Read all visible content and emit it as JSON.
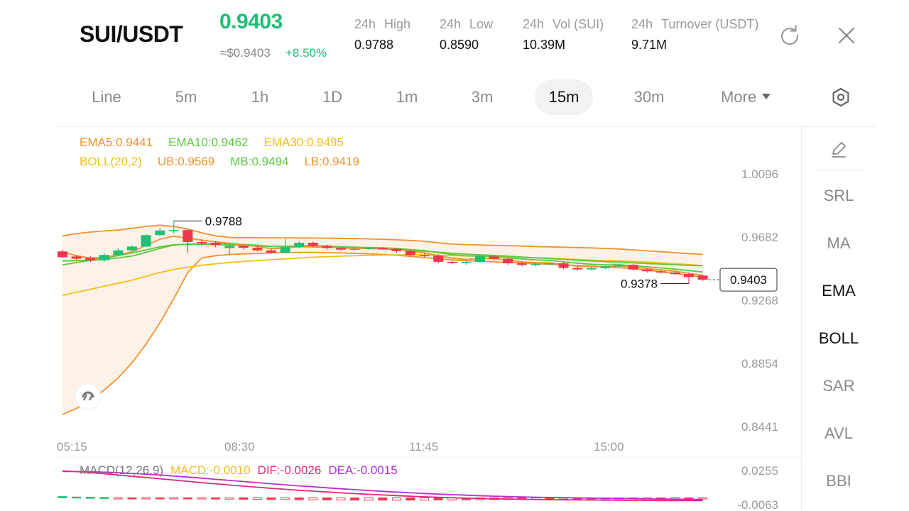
{
  "header": {
    "pair": "SUI/USDT",
    "last_price": "0.9403",
    "usd_price": "≈$0.9403",
    "change": "+8.50%",
    "stats": [
      {
        "k1": "24h",
        "k2": "High",
        "value": "0.9788"
      },
      {
        "k1": "24h",
        "k2": "Low",
        "value": "0.8590"
      },
      {
        "k1": "24h",
        "k2": "Vol (SUI)",
        "value": "10.39M"
      },
      {
        "k1": "24h",
        "k2": "Turnover (USDT)",
        "value": "9.71M"
      }
    ],
    "icons": {
      "refresh": "refresh-icon",
      "close": "close-icon"
    }
  },
  "timeframes": {
    "items": [
      "Line",
      "5m",
      "1h",
      "1D",
      "1m",
      "3m",
      "15m",
      "30m"
    ],
    "active": "15m",
    "more_label": "More",
    "settings_icon": "hexagon-settings-icon"
  },
  "indicators": {
    "ema5": "EMA5:0.9441",
    "ema10": "EMA10:0.9462",
    "ema30": "EMA30:0.9495",
    "boll": "BOLL(20,2)",
    "ub": "UB:0.9569",
    "mb": "MB:0.9494",
    "lb": "LB:0.9419",
    "macd_title": "MACD(12,26,9)",
    "macd": "MACD:-0.0010",
    "dif": "DIF:-0.0026",
    "dea": "DEA:-0.0015"
  },
  "sidebar": {
    "draw_icon": "pencil-icon",
    "items": [
      "SRL",
      "MA",
      "EMA",
      "BOLL",
      "SAR",
      "AVL",
      "BBI"
    ],
    "active": [
      "EMA",
      "BOLL"
    ]
  },
  "colors": {
    "up": "#1fbf75",
    "down": "#f0364f",
    "ema5": "#f0922e",
    "ema10": "#5ac93f",
    "ema30": "#f2be1a",
    "boll_band": "#f0922e",
    "boll_fill": "#fdeee0",
    "dif": "#e0297c",
    "dea": "#b32fd3"
  },
  "chart_data": {
    "type": "candlestick",
    "y_ticks": [
      "1.0096",
      "0.9682",
      "0.9268",
      "0.8854",
      "0.8441"
    ],
    "ylim": [
      0.8441,
      1.0096
    ],
    "x_ticks": [
      "05:15",
      "08:30",
      "11:45",
      "15:00"
    ],
    "high_marker": "0.9788",
    "low_marker": "0.9378",
    "current_price_tag": "0.9403",
    "candles": [
      {
        "o": 0.9588,
        "c": 0.955,
        "h": 0.96,
        "l": 0.9545
      },
      {
        "o": 0.9555,
        "c": 0.954,
        "h": 0.9565,
        "l": 0.953
      },
      {
        "o": 0.9545,
        "c": 0.953,
        "h": 0.9558,
        "l": 0.9518
      },
      {
        "o": 0.953,
        "c": 0.9565,
        "h": 0.9575,
        "l": 0.952
      },
      {
        "o": 0.9565,
        "c": 0.9595,
        "h": 0.9608,
        "l": 0.956
      },
      {
        "o": 0.9595,
        "c": 0.962,
        "h": 0.9628,
        "l": 0.9585
      },
      {
        "o": 0.962,
        "c": 0.9695,
        "h": 0.97,
        "l": 0.9615
      },
      {
        "o": 0.9695,
        "c": 0.9725,
        "h": 0.974,
        "l": 0.969
      },
      {
        "o": 0.9725,
        "c": 0.9728,
        "h": 0.9788,
        "l": 0.9705
      },
      {
        "o": 0.9728,
        "c": 0.965,
        "h": 0.9735,
        "l": 0.958
      },
      {
        "o": 0.965,
        "c": 0.9645,
        "h": 0.9668,
        "l": 0.9628
      },
      {
        "o": 0.9645,
        "c": 0.963,
        "h": 0.9655,
        "l": 0.9615
      },
      {
        "o": 0.961,
        "c": 0.9625,
        "h": 0.9632,
        "l": 0.9565
      },
      {
        "o": 0.9625,
        "c": 0.9612,
        "h": 0.9632,
        "l": 0.96
      },
      {
        "o": 0.9612,
        "c": 0.9595,
        "h": 0.9622,
        "l": 0.9588
      },
      {
        "o": 0.9595,
        "c": 0.958,
        "h": 0.9605,
        "l": 0.9572
      },
      {
        "o": 0.958,
        "c": 0.9615,
        "h": 0.9668,
        "l": 0.9575
      },
      {
        "o": 0.9615,
        "c": 0.9645,
        "h": 0.9655,
        "l": 0.9608
      },
      {
        "o": 0.9645,
        "c": 0.9625,
        "h": 0.9652,
        "l": 0.9615
      },
      {
        "o": 0.9625,
        "c": 0.961,
        "h": 0.9632,
        "l": 0.96
      },
      {
        "o": 0.961,
        "c": 0.96,
        "h": 0.9618,
        "l": 0.959
      },
      {
        "o": 0.96,
        "c": 0.9605,
        "h": 0.9612,
        "l": 0.9592
      },
      {
        "o": 0.9605,
        "c": 0.961,
        "h": 0.9615,
        "l": 0.9598
      },
      {
        "o": 0.961,
        "c": 0.9605,
        "h": 0.9618,
        "l": 0.96
      },
      {
        "o": 0.9605,
        "c": 0.959,
        "h": 0.9612,
        "l": 0.958
      },
      {
        "o": 0.959,
        "c": 0.9565,
        "h": 0.96,
        "l": 0.955
      },
      {
        "o": 0.9565,
        "c": 0.956,
        "h": 0.9575,
        "l": 0.955
      },
      {
        "o": 0.956,
        "c": 0.952,
        "h": 0.9568,
        "l": 0.951
      },
      {
        "o": 0.952,
        "c": 0.9512,
        "h": 0.953,
        "l": 0.9505
      },
      {
        "o": 0.9512,
        "c": 0.952,
        "h": 0.9528,
        "l": 0.95
      },
      {
        "o": 0.952,
        "c": 0.9555,
        "h": 0.9562,
        "l": 0.9515
      },
      {
        "o": 0.9555,
        "c": 0.954,
        "h": 0.9562,
        "l": 0.953
      },
      {
        "o": 0.954,
        "c": 0.951,
        "h": 0.9548,
        "l": 0.95
      },
      {
        "o": 0.951,
        "c": 0.95,
        "h": 0.952,
        "l": 0.949
      },
      {
        "o": 0.95,
        "c": 0.9505,
        "h": 0.9512,
        "l": 0.9492
      },
      {
        "o": 0.9505,
        "c": 0.951,
        "h": 0.9516,
        "l": 0.9498
      },
      {
        "o": 0.951,
        "c": 0.948,
        "h": 0.9518,
        "l": 0.947
      },
      {
        "o": 0.948,
        "c": 0.947,
        "h": 0.949,
        "l": 0.9462
      },
      {
        "o": 0.947,
        "c": 0.9478,
        "h": 0.9485,
        "l": 0.9465
      },
      {
        "o": 0.9478,
        "c": 0.949,
        "h": 0.9496,
        "l": 0.9472
      },
      {
        "o": 0.949,
        "c": 0.9502,
        "h": 0.9508,
        "l": 0.9484
      },
      {
        "o": 0.95,
        "c": 0.947,
        "h": 0.9506,
        "l": 0.9462
      },
      {
        "o": 0.947,
        "c": 0.9458,
        "h": 0.9478,
        "l": 0.945
      },
      {
        "o": 0.9458,
        "c": 0.945,
        "h": 0.9466,
        "l": 0.9444
      },
      {
        "o": 0.945,
        "c": 0.944,
        "h": 0.9458,
        "l": 0.9432
      },
      {
        "o": 0.944,
        "c": 0.942,
        "h": 0.9448,
        "l": 0.9378
      },
      {
        "o": 0.943,
        "c": 0.9403,
        "h": 0.9436,
        "l": 0.9395
      }
    ],
    "ema5": [
      0.9585,
      0.956,
      0.9545,
      0.955,
      0.9565,
      0.9585,
      0.9628,
      0.9668,
      0.9688,
      0.9675,
      0.9662,
      0.9651,
      0.9642,
      0.9632,
      0.962,
      0.9606,
      0.9609,
      0.9621,
      0.9622,
      0.9618,
      0.9612,
      0.9609,
      0.9609,
      0.9608,
      0.9602,
      0.959,
      0.958,
      0.956,
      0.9544,
      0.9536,
      0.9542,
      0.9541,
      0.9531,
      0.952,
      0.9515,
      0.9513,
      0.9502,
      0.9491,
      0.9487,
      0.9488,
      0.9493,
      0.9485,
      0.9476,
      0.9467,
      0.9458,
      0.9445,
      0.9431
    ],
    "ema10": [
      0.9525,
      0.9528,
      0.953,
      0.9536,
      0.9545,
      0.9558,
      0.9582,
      0.9608,
      0.963,
      0.9636,
      0.9638,
      0.9638,
      0.9637,
      0.9634,
      0.9629,
      0.9622,
      0.9621,
      0.9625,
      0.9625,
      0.9623,
      0.9619,
      0.9616,
      0.9614,
      0.9612,
      0.9608,
      0.96,
      0.9593,
      0.958,
      0.9568,
      0.9559,
      0.9558,
      0.9555,
      0.9547,
      0.9539,
      0.9533,
      0.9529,
      0.952,
      0.9511,
      0.9504,
      0.9501,
      0.95,
      0.9494,
      0.9487,
      0.948,
      0.9472,
      0.9463,
      0.9453
    ],
    "ema30": [
      0.93,
      0.932,
      0.934,
      0.936,
      0.938,
      0.94,
      0.9425,
      0.945,
      0.947,
      0.9485,
      0.9497,
      0.9507,
      0.9516,
      0.9523,
      0.9529,
      0.9534,
      0.9539,
      0.9545,
      0.955,
      0.9554,
      0.9557,
      0.956,
      0.9562,
      0.9564,
      0.9565,
      0.9565,
      0.9565,
      0.9563,
      0.9561,
      0.9558,
      0.9557,
      0.9556,
      0.9553,
      0.955,
      0.9547,
      0.9544,
      0.954,
      0.9535,
      0.9531,
      0.9528,
      0.9526,
      0.9522,
      0.9518,
      0.9513,
      0.9508,
      0.9502,
      0.9495
    ],
    "boll_ub": [
      0.969,
      0.9705,
      0.9715,
      0.9722,
      0.9728,
      0.974,
      0.9752,
      0.976,
      0.9752,
      0.9735,
      0.971,
      0.969,
      0.968,
      0.9678,
      0.9678,
      0.9677,
      0.9677,
      0.9676,
      0.9676,
      0.9675,
      0.9674,
      0.9672,
      0.967,
      0.9668,
      0.9664,
      0.966,
      0.9655,
      0.9645,
      0.9636,
      0.9633,
      0.963,
      0.9628,
      0.9626,
      0.9623,
      0.962,
      0.9618,
      0.9616,
      0.9613,
      0.9611,
      0.9608,
      0.9604,
      0.9598,
      0.9592,
      0.9586,
      0.958,
      0.9574,
      0.9569
    ],
    "boll_mb": [
      0.95,
      0.9515,
      0.953,
      0.9545,
      0.956,
      0.9578,
      0.9598,
      0.9618,
      0.9632,
      0.9634,
      0.9634,
      0.9633,
      0.9631,
      0.9628,
      0.9624,
      0.962,
      0.9618,
      0.9619,
      0.9618,
      0.9616,
      0.9613,
      0.961,
      0.9607,
      0.9604,
      0.96,
      0.9595,
      0.959,
      0.9583,
      0.9576,
      0.957,
      0.9566,
      0.9562,
      0.9557,
      0.9551,
      0.9546,
      0.9541,
      0.9536,
      0.953,
      0.9525,
      0.9521,
      0.9518,
      0.9513,
      0.9509,
      0.9505,
      0.9501,
      0.9497,
      0.9494
    ],
    "boll_lb": [
      0.852,
      0.856,
      0.861,
      0.868,
      0.876,
      0.886,
      0.898,
      0.912,
      0.928,
      0.945,
      0.9545,
      0.956,
      0.9568,
      0.9572,
      0.9575,
      0.9578,
      0.958,
      0.9582,
      0.9582,
      0.958,
      0.9578,
      0.9575,
      0.9572,
      0.9568,
      0.9563,
      0.9556,
      0.9548,
      0.954,
      0.9533,
      0.9528,
      0.9524,
      0.952,
      0.9516,
      0.9512,
      0.9508,
      0.9504,
      0.95,
      0.9496,
      0.9492,
      0.9487,
      0.9482,
      0.9474,
      0.9465,
      0.9455,
      0.9444,
      0.9432,
      0.9419
    ],
    "macd_y_ticks": [
      "0.0255",
      "-0.0063"
    ],
    "macd_ylim": [
      -0.0063,
      0.0255
    ],
    "dif": [
      0.0252,
      0.0245,
      0.0236,
      0.0225,
      0.0213,
      0.0201,
      0.019,
      0.0178,
      0.0166,
      0.0154,
      0.0142,
      0.0131,
      0.012,
      0.0109,
      0.0099,
      0.0089,
      0.008,
      0.0071,
      0.0063,
      0.0055,
      0.0047,
      0.004,
      0.0033,
      0.0027,
      0.0021,
      0.0015,
      0.001,
      0.0005,
      0.0001,
      -0.0003,
      -0.0006,
      -0.0009,
      -0.0011,
      -0.0013,
      -0.0015,
      -0.0017,
      -0.0018,
      -0.0019,
      -0.002,
      -0.0021,
      -0.0022,
      -0.0023,
      -0.0024,
      -0.0025,
      -0.0025,
      -0.0026,
      -0.0026
    ],
    "dea": [
      0.0246,
      0.0246,
      0.0244,
      0.024,
      0.0235,
      0.0228,
      0.0221,
      0.0213,
      0.0203,
      0.0194,
      0.0184,
      0.0173,
      0.0163,
      0.0152,
      0.0142,
      0.0132,
      0.0122,
      0.0112,
      0.0103,
      0.0094,
      0.0085,
      0.0077,
      0.0069,
      0.0061,
      0.0054,
      0.0047,
      0.0041,
      0.0035,
      0.003,
      0.0025,
      0.002,
      0.0016,
      0.0012,
      0.0009,
      0.0006,
      0.0004,
      0.0002,
      0.0,
      -0.0002,
      -0.0004,
      -0.0006,
      -0.0008,
      -0.001,
      -0.0011,
      -0.0012,
      -0.0014,
      -0.0015
    ],
    "macd_hist": [
      0.0012,
      0.0008,
      0.0006,
      0.0004,
      -0.0002,
      -0.0003,
      -0.0004,
      -0.0005,
      -0.0006,
      -0.0008,
      -0.001,
      -0.0011,
      -0.0012,
      -0.0013,
      -0.0014,
      -0.0015,
      -0.0016,
      -0.0017,
      -0.0018,
      -0.0019,
      -0.002,
      -0.0021,
      -0.0021,
      -0.0021,
      -0.0021,
      -0.0021,
      -0.0021,
      -0.002,
      -0.0019,
      -0.0018,
      -0.0017,
      -0.0016,
      -0.0015,
      -0.0014,
      -0.0013,
      -0.0012,
      -0.0011,
      -0.001,
      -0.0009,
      -0.0008,
      -0.0007,
      -0.0006,
      -0.0005,
      -0.0005,
      -0.0004,
      -0.0004,
      -0.001
    ]
  }
}
